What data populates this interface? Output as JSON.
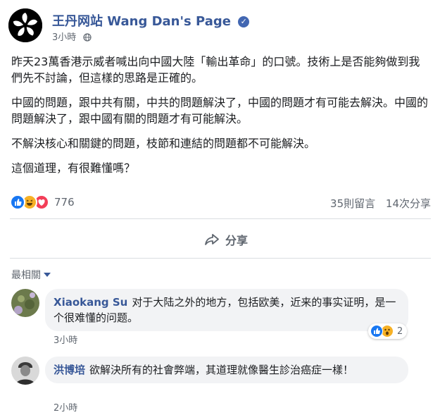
{
  "post": {
    "page_name": "王丹网站 Wang Dan's Page",
    "time": "3小時",
    "paragraphs": [
      "昨天23萬香港示威者喊出向中國大陸「輸出革命」的口號。技術上是否能夠做到我們先不討論，但這樣的思路是正確的。",
      "中國的問題，跟中共有關，中共的問題解決了，中國的問題才有可能去解決。中國的問題解決了，跟中國有關的問題才有可能解決。",
      "不解決核心和關鍵的問題，枝節和連結的問題都不可能解決。",
      "這個道理，有很難懂嗎？"
    ],
    "reaction_count": "776",
    "comment_count": "35則留言",
    "share_count": "14次分享",
    "share_label": "分享"
  },
  "comments_filter": "最相關",
  "comments": [
    {
      "author": "Xiaokang Su",
      "text": "对于大陆之外的地方，包括欧美，近来的事实证明，是一个很难懂的问题。",
      "time": "3小時",
      "reaction_count": "2"
    },
    {
      "author": "洪博培",
      "text": "欲解決所有的社會弊端，其道理就像醫生診治癌症一樣！",
      "time": "2小時"
    }
  ],
  "colors": {
    "link": "#385898",
    "muted": "#606770",
    "like": "#1877f2",
    "love": "#f33e58",
    "haha": "#f7b125"
  }
}
